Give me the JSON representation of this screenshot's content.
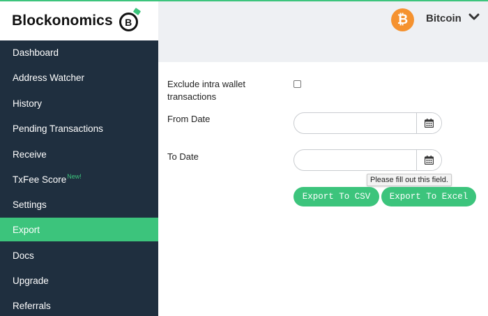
{
  "brand": {
    "name": "Blockonomics",
    "logo_letter": "B"
  },
  "topbar": {
    "coin_symbol": "₿",
    "coin_label": "Bitcoin",
    "coin_color": "#f5922f"
  },
  "sidebar": {
    "items": [
      {
        "label": "Dashboard"
      },
      {
        "label": "Address Watcher"
      },
      {
        "label": "History"
      },
      {
        "label": "Pending Transactions"
      },
      {
        "label": "Receive"
      },
      {
        "label": "TxFee Score",
        "badge": "New!"
      },
      {
        "label": "Settings"
      },
      {
        "label": "Export",
        "active": true
      },
      {
        "label": "Docs"
      },
      {
        "label": "Upgrade"
      },
      {
        "label": "Referrals"
      }
    ]
  },
  "form": {
    "exclude_label_line1": "Exclude intra wallet",
    "exclude_label_line2": "transactions",
    "from_label": "From Date",
    "from_value": "",
    "to_label": "To Date",
    "to_value": "",
    "validation_tooltip": "Please fill out this field.",
    "export_csv_label": "Export To CSV",
    "export_excel_label": "Export To Excel"
  },
  "colors": {
    "accent": "#3cc47c",
    "sidebar": "#1f2f3f",
    "topbar": "#eef0f3"
  }
}
